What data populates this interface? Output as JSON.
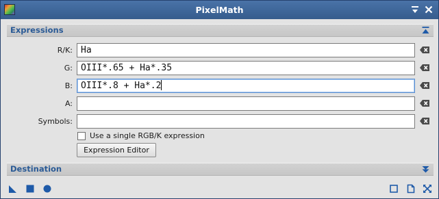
{
  "window": {
    "title": "PixelMath"
  },
  "expressions": {
    "section_label": "Expressions",
    "rows": [
      {
        "label": "R/K:",
        "value": "Ha"
      },
      {
        "label": "G:",
        "value": "OIII*.65 + Ha*.35"
      },
      {
        "label": "B:",
        "value": "OIII*.8 + Ha*.2"
      },
      {
        "label": "A:",
        "value": ""
      },
      {
        "label": "Symbols:",
        "value": ""
      }
    ],
    "single_rgbk_checkbox": {
      "label": "Use a single RGB/K expression",
      "checked": false
    },
    "editor_button_label": "Expression Editor"
  },
  "destination": {
    "section_label": "Destination"
  },
  "colors": {
    "titlebar": "#3e6699",
    "section_text": "#2a5a95",
    "icon_blue": "#1e5aa8"
  }
}
